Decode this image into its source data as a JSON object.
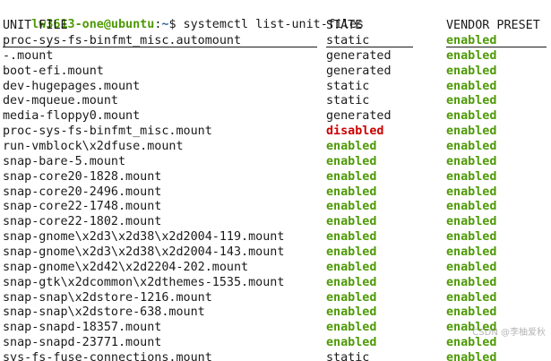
{
  "prompt": {
    "user_host": "lw3613-one@ubuntu",
    "separator": ":",
    "path": "~",
    "dollar": "$",
    "command": " systemctl list-unit-files"
  },
  "header": {
    "col1": "UNIT FILE",
    "col2": "STATE",
    "col3": "VENDOR PRESET"
  },
  "rows": [
    {
      "unit": "proc-sys-fs-binfmt_misc.automount",
      "state": "static",
      "state_kind": "plain",
      "preset": "enabled",
      "preset_kind": "enabled"
    },
    {
      "unit": "-.mount",
      "state": "generated",
      "state_kind": "plain",
      "preset": "enabled",
      "preset_kind": "enabled"
    },
    {
      "unit": "boot-efi.mount",
      "state": "generated",
      "state_kind": "plain",
      "preset": "enabled",
      "preset_kind": "enabled"
    },
    {
      "unit": "dev-hugepages.mount",
      "state": "static",
      "state_kind": "plain",
      "preset": "enabled",
      "preset_kind": "enabled"
    },
    {
      "unit": "dev-mqueue.mount",
      "state": "static",
      "state_kind": "plain",
      "preset": "enabled",
      "preset_kind": "enabled"
    },
    {
      "unit": "media-floppy0.mount",
      "state": "generated",
      "state_kind": "plain",
      "preset": "enabled",
      "preset_kind": "enabled"
    },
    {
      "unit": "proc-sys-fs-binfmt_misc.mount",
      "state": "disabled",
      "state_kind": "disabled",
      "preset": "enabled",
      "preset_kind": "enabled"
    },
    {
      "unit": "run-vmblock\\x2dfuse.mount",
      "state": "enabled",
      "state_kind": "enabled",
      "preset": "enabled",
      "preset_kind": "enabled"
    },
    {
      "unit": "snap-bare-5.mount",
      "state": "enabled",
      "state_kind": "enabled",
      "preset": "enabled",
      "preset_kind": "enabled"
    },
    {
      "unit": "snap-core20-1828.mount",
      "state": "enabled",
      "state_kind": "enabled",
      "preset": "enabled",
      "preset_kind": "enabled"
    },
    {
      "unit": "snap-core20-2496.mount",
      "state": "enabled",
      "state_kind": "enabled",
      "preset": "enabled",
      "preset_kind": "enabled"
    },
    {
      "unit": "snap-core22-1748.mount",
      "state": "enabled",
      "state_kind": "enabled",
      "preset": "enabled",
      "preset_kind": "enabled"
    },
    {
      "unit": "snap-core22-1802.mount",
      "state": "enabled",
      "state_kind": "enabled",
      "preset": "enabled",
      "preset_kind": "enabled"
    },
    {
      "unit": "snap-gnome\\x2d3\\x2d38\\x2d2004-119.mount",
      "state": "enabled",
      "state_kind": "enabled",
      "preset": "enabled",
      "preset_kind": "enabled"
    },
    {
      "unit": "snap-gnome\\x2d3\\x2d38\\x2d2004-143.mount",
      "state": "enabled",
      "state_kind": "enabled",
      "preset": "enabled",
      "preset_kind": "enabled"
    },
    {
      "unit": "snap-gnome\\x2d42\\x2d2204-202.mount",
      "state": "enabled",
      "state_kind": "enabled",
      "preset": "enabled",
      "preset_kind": "enabled"
    },
    {
      "unit": "snap-gtk\\x2dcommon\\x2dthemes-1535.mount",
      "state": "enabled",
      "state_kind": "enabled",
      "preset": "enabled",
      "preset_kind": "enabled"
    },
    {
      "unit": "snap-snap\\x2dstore-1216.mount",
      "state": "enabled",
      "state_kind": "enabled",
      "preset": "enabled",
      "preset_kind": "enabled"
    },
    {
      "unit": "snap-snap\\x2dstore-638.mount",
      "state": "enabled",
      "state_kind": "enabled",
      "preset": "enabled",
      "preset_kind": "enabled"
    },
    {
      "unit": "snap-snapd-18357.mount",
      "state": "enabled",
      "state_kind": "enabled",
      "preset": "enabled",
      "preset_kind": "enabled"
    },
    {
      "unit": "snap-snapd-23771.mount",
      "state": "enabled",
      "state_kind": "enabled",
      "preset": "enabled",
      "preset_kind": "enabled"
    },
    {
      "unit": "sys-fs-fuse-connections.mount",
      "state": "static",
      "state_kind": "plain",
      "preset": "enabled",
      "preset_kind": "enabled"
    }
  ],
  "watermark": "CSDN @李柚爱秋",
  "colors": {
    "user_host": "#4e9a06",
    "path": "#3465a4",
    "enabled": "#4e9a06",
    "disabled": "#cc0000",
    "text": "#1a1a1a",
    "background": "#ffffff"
  }
}
